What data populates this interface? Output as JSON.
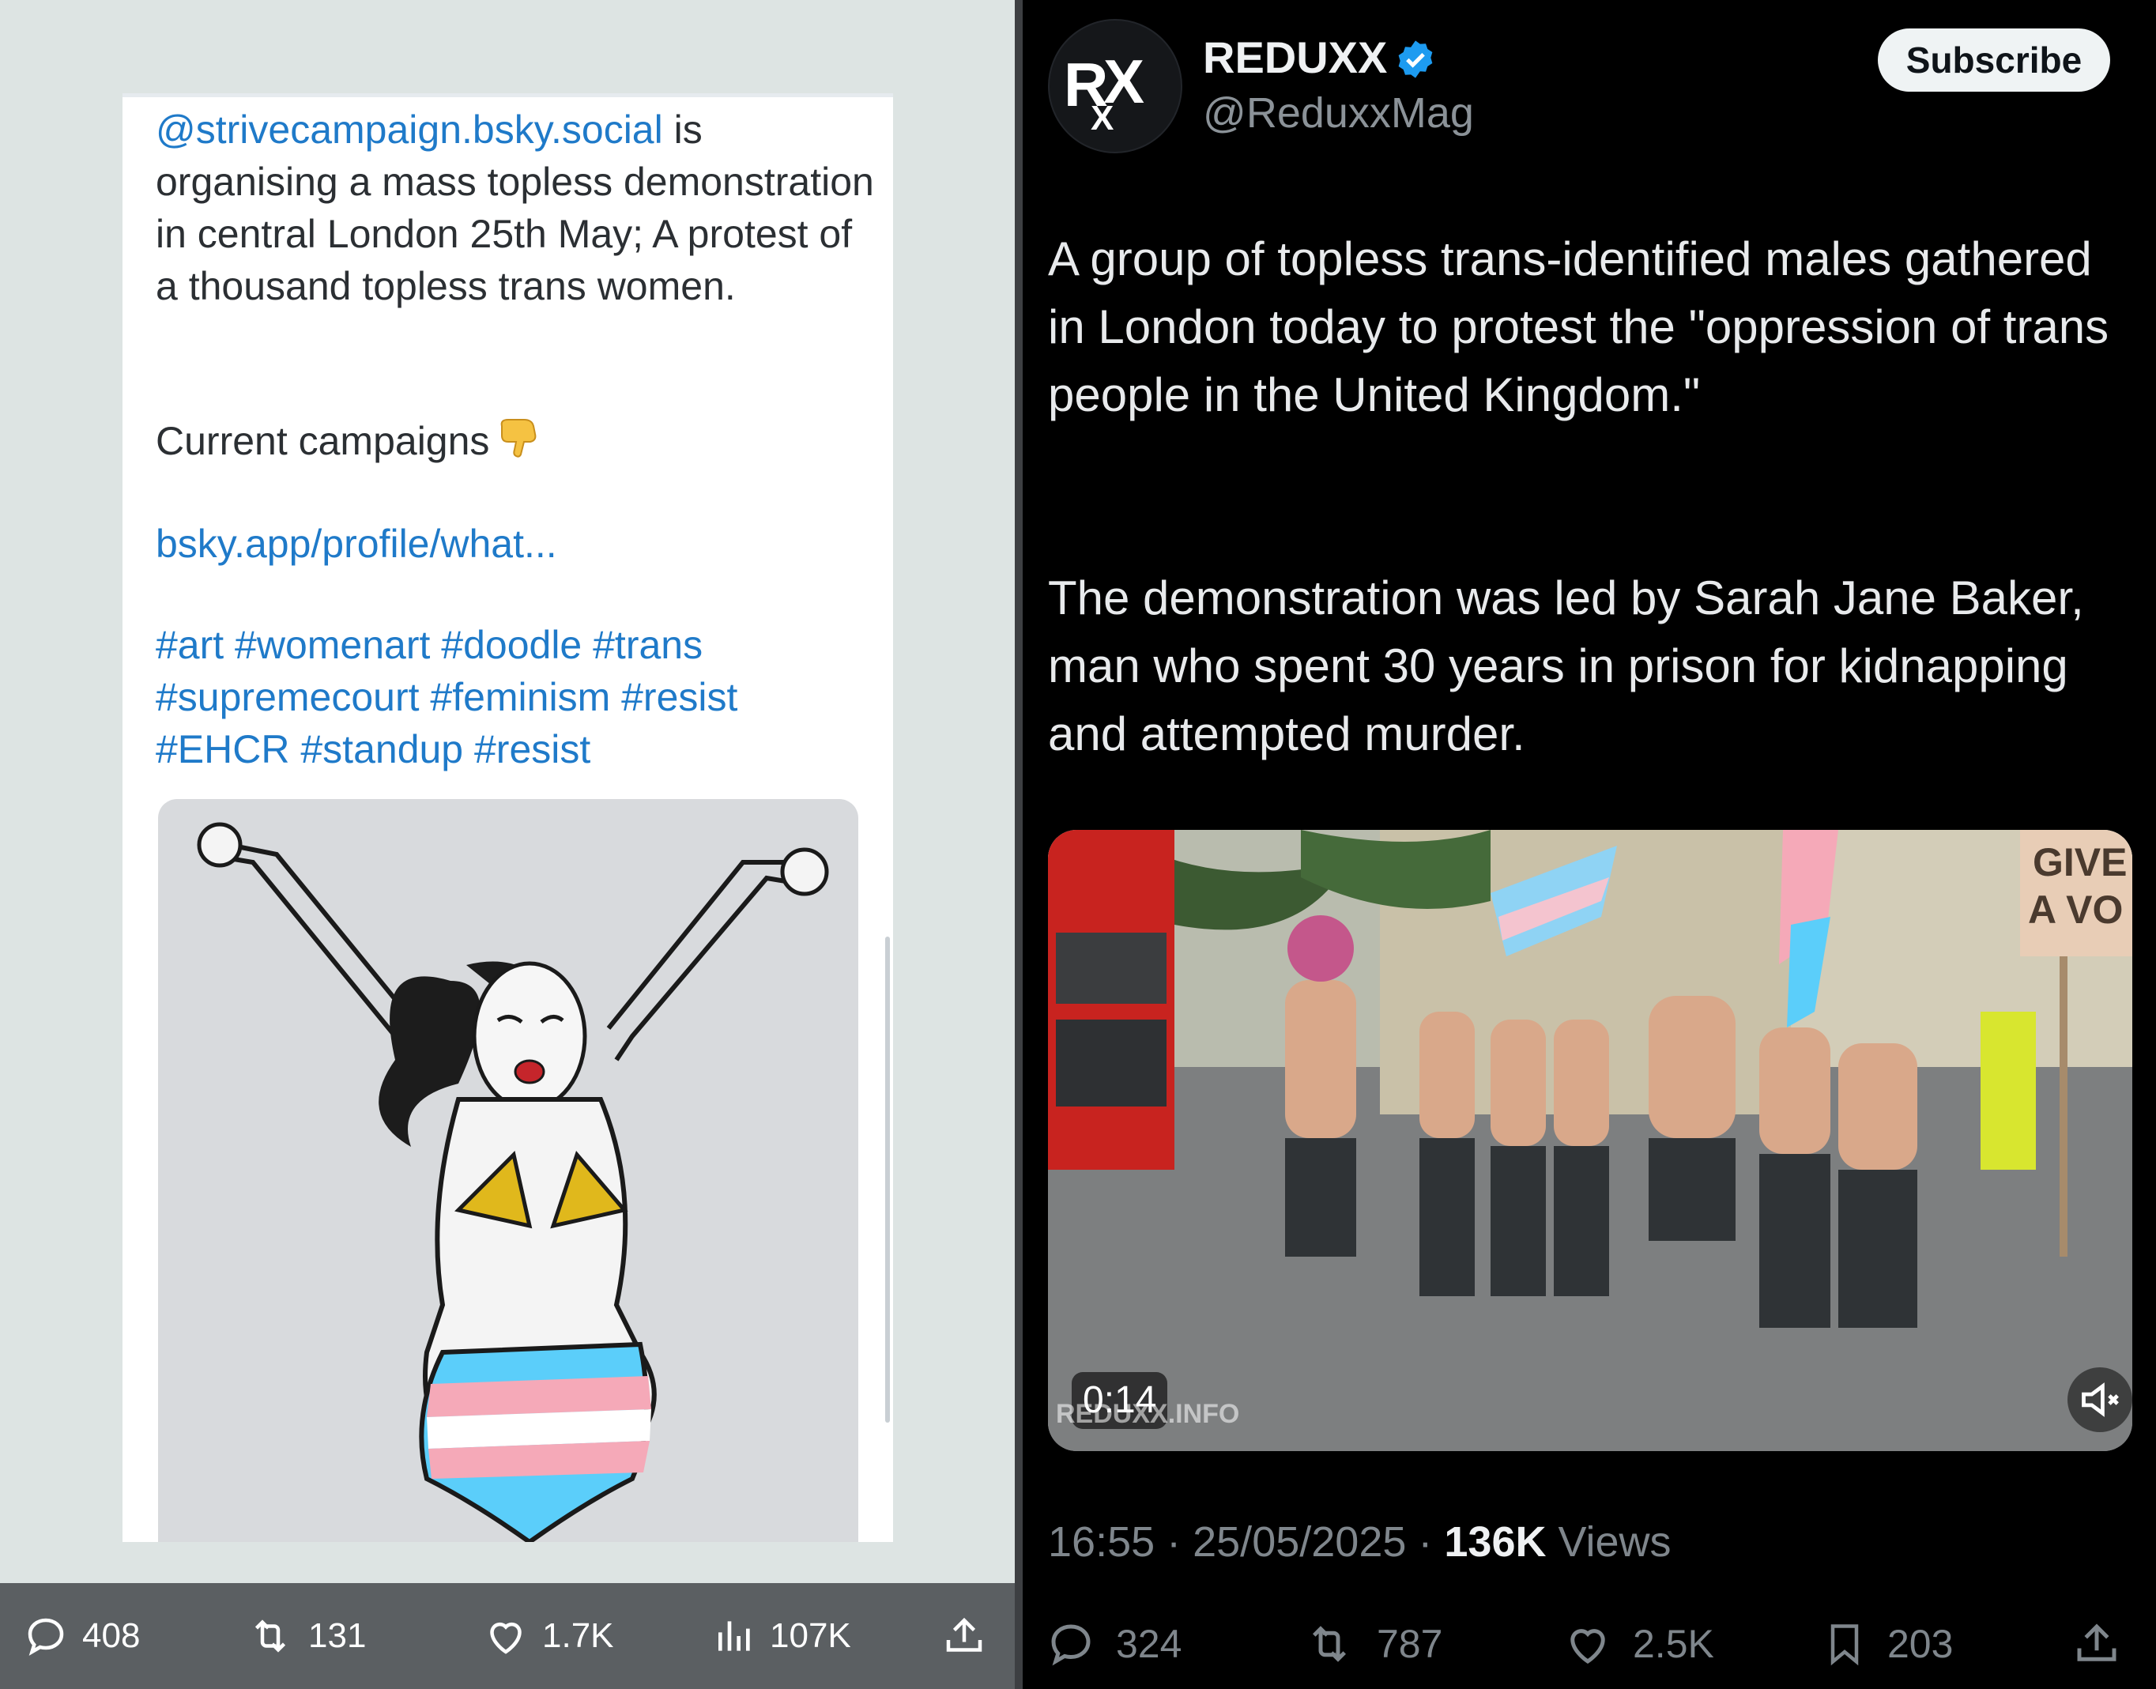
{
  "left_post": {
    "mention": "@strivecampaign.bsky.social",
    "text_after_mention": " is organising a mass topless demonstration in central London 25th May; A protest of a thousand topless trans women.",
    "campaigns_label": "Current campaigns",
    "link": "bsky.app/profile/what...",
    "hashtags_line1": "#art #womenart #doodle #trans",
    "hashtags_line2": "#supremecourt #feminism #resist",
    "hashtags_line3": "#EHCR #standup #resist",
    "stats": {
      "replies": "408",
      "reposts": "131",
      "likes": "1.7K",
      "views": "107K"
    }
  },
  "right_post": {
    "author_name": "REDUXX",
    "avatar_text": "RXX",
    "handle": "@ReduxxMag",
    "subscribe_label": "Subscribe",
    "paragraph1": "A group of topless trans-identified males gathered in London today to protest the \"oppression of trans people in the United Kingdom.\"",
    "paragraph2": "The demonstration was led by Sarah Jane Baker, man who spent 30 years in prison for kidnapping and attempted murder.",
    "video": {
      "duration": "0:14",
      "watermark": "REDUXX.INFO",
      "sign_text_line1": "GIVE",
      "sign_text_line2": "A VO"
    },
    "timestamp": "16:55 · 25/05/2025 · ",
    "views_count": "136K",
    "views_label": " Views",
    "stats": {
      "replies": "324",
      "reposts": "787",
      "likes": "2.5K",
      "bookmarks": "203"
    }
  },
  "colors": {
    "left_background": "#dde4e3",
    "link_blue": "#1f7ac9",
    "left_action_bar": "#5b5f62",
    "right_background": "#000000",
    "verified_blue": "#1d9bf0",
    "trans_blue": "#5bcefa",
    "trans_pink": "#f5a9b8"
  },
  "icons": [
    "reply-icon",
    "repost-icon",
    "like-icon",
    "views-icon",
    "share-icon",
    "bookmark-icon",
    "verified-badge-icon",
    "mute-icon",
    "pointing-down-emoji"
  ]
}
